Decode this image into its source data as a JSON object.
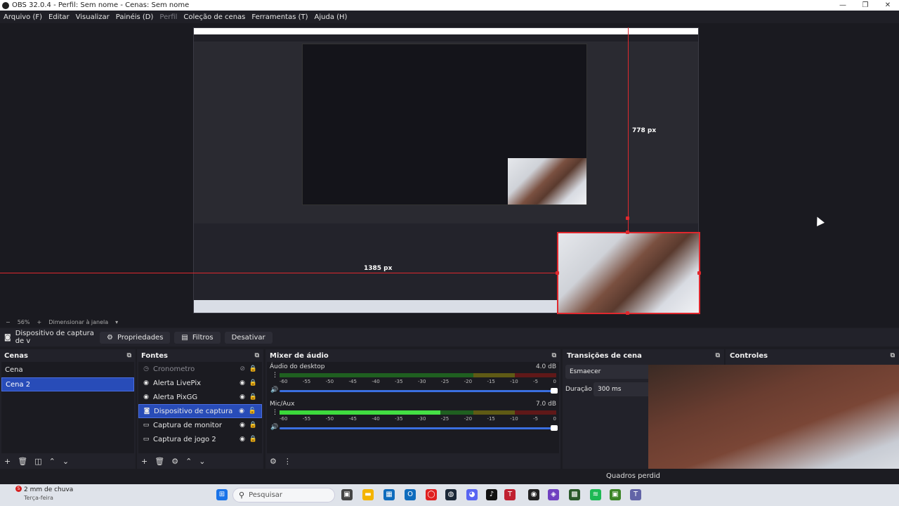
{
  "window": {
    "title": "OBS 32.0.4 - Perfil: Sem nome - Cenas: Sem nome",
    "controls": [
      "—",
      "❐",
      "✕"
    ]
  },
  "menu": [
    {
      "label": "Arquivo (F)",
      "disabled": false
    },
    {
      "label": "Editar",
      "disabled": false
    },
    {
      "label": "Visualizar",
      "disabled": false
    },
    {
      "label": "Painéis (D)",
      "disabled": false
    },
    {
      "label": "Perfil",
      "disabled": true
    },
    {
      "label": "Coleção de cenas",
      "disabled": false
    },
    {
      "label": "Ferramentas (T)",
      "disabled": false
    },
    {
      "label": "Ajuda (H)",
      "disabled": false
    }
  ],
  "preview": {
    "height_label": "778 px",
    "width_label": "1385 px",
    "zoom": "56%",
    "zoom_minus": "−",
    "zoom_plus": "+",
    "fit_label": "Dimensionar à janela"
  },
  "source_toolbar": {
    "source_name": "Dispositivo de captura de v",
    "properties": "Propriedades",
    "filters": "Filtros",
    "deactivate": "Desativar"
  },
  "scenes": {
    "title": "Cenas",
    "items": [
      "Cena",
      "Cena 2"
    ],
    "selected": 1
  },
  "sources": {
    "title": "Fontes",
    "items": [
      {
        "name": "Cronometro",
        "icon": "stopwatch-icon",
        "glyph": "◷",
        "hidden": true
      },
      {
        "name": "Alerta LivePix",
        "icon": "browser-icon",
        "glyph": "◉",
        "hidden": false
      },
      {
        "name": "Alerta PixGG",
        "icon": "browser-icon",
        "glyph": "◉",
        "hidden": false
      },
      {
        "name": "Dispositivo de captura de vi",
        "icon": "camera-icon",
        "glyph": "◙",
        "hidden": false,
        "selected": true
      },
      {
        "name": "Captura de monitor",
        "icon": "monitor-icon",
        "glyph": "▭",
        "hidden": false
      },
      {
        "name": "Captura de jogo 2",
        "icon": "gamepad-icon",
        "glyph": "▭",
        "hidden": false
      }
    ]
  },
  "mixer": {
    "title": "Mixer de áudio",
    "scale": [
      "-60",
      "-55",
      "-50",
      "-45",
      "-40",
      "-35",
      "-30",
      "-25",
      "-20",
      "-15",
      "-10",
      "-5",
      "0"
    ],
    "channels": [
      {
        "name": "Áudio do desktop",
        "db": "4.0 dB",
        "level": 0
      },
      {
        "name": "Mic/Aux",
        "db": "7.0 dB",
        "level": 0.58
      }
    ]
  },
  "transitions": {
    "title": "Transições de cena",
    "type": "Esmaecer",
    "duration_label": "Duração",
    "duration": "300 ms"
  },
  "controls": {
    "title": "Controles"
  },
  "status": {
    "frames": "Quadros perdid"
  },
  "taskbar": {
    "weather": "2 mm de chuva",
    "weather_sub": "Terça-feira",
    "weather_badge": "5",
    "search_placeholder": "Pesquisar",
    "colors": {
      "start": "#1a73e8",
      "explorer": "#f4b400",
      "outlook": "#0f6cbd",
      "steam": "#1b2838",
      "discord": "#5865f2",
      "tiktok": "#111111",
      "spotify": "#1db954",
      "minecraft": "#3c8527",
      "teams": "#6264a7"
    }
  }
}
